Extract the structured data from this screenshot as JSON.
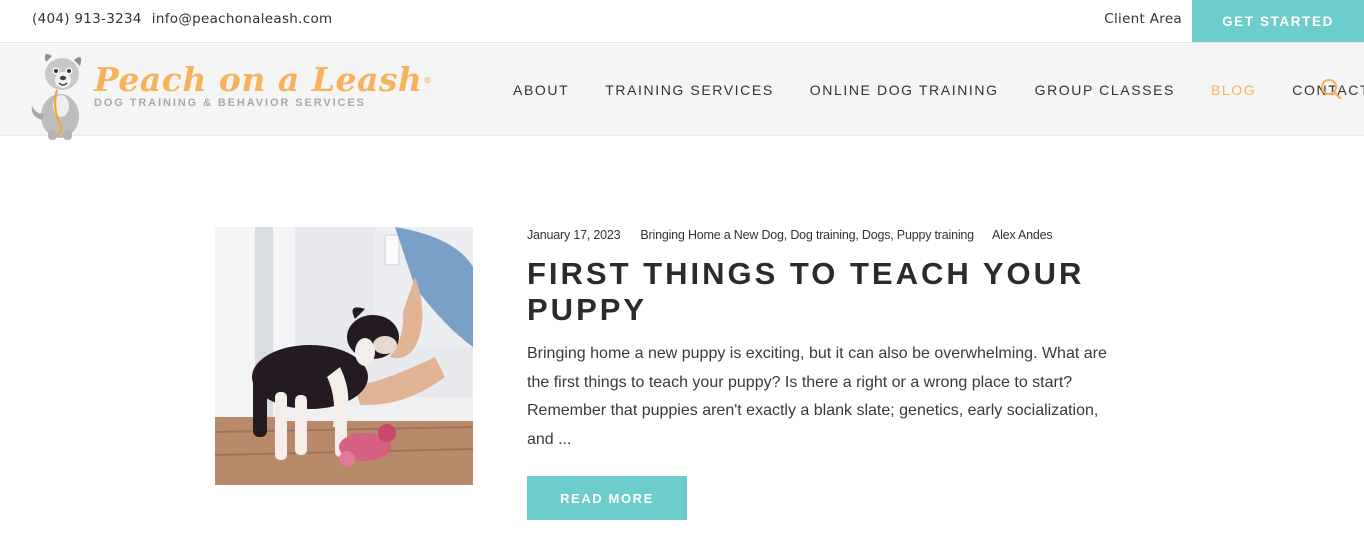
{
  "topbar": {
    "phone": "(404) 913-3234",
    "email": "info@peachonaleash.com",
    "client_area": "Client Area",
    "cta_label": "GET STARTED"
  },
  "brand": {
    "name": "Peach on a Leash",
    "tagline": "DOG TRAINING & BEHAVIOR SERVICES",
    "reg_mark": "®"
  },
  "nav": {
    "items": [
      {
        "label": "ABOUT",
        "active": false
      },
      {
        "label": "TRAINING SERVICES",
        "active": false
      },
      {
        "label": "ONLINE DOG TRAINING",
        "active": false
      },
      {
        "label": "GROUP CLASSES",
        "active": false
      },
      {
        "label": "BLOG",
        "active": true
      },
      {
        "label": "CONTACT",
        "active": false
      }
    ],
    "search_icon": "search-icon"
  },
  "post": {
    "date": "January 17, 2023",
    "categories": "Bringing Home a New Dog, Dog training, Dogs, Puppy training",
    "author": "Alex Andes",
    "title": "FIRST THINGS TO TEACH YOUR PUPPY",
    "excerpt": "Bringing home a new puppy is exciting, but it can also be overwhelming. What are the first things to teach your puppy? Is there a right or a wrong place to start? Remember that puppies aren't exactly a blank slate; genetics, early socialization, and ...",
    "read_more": "READ MORE"
  },
  "colors": {
    "accent_teal": "#6ccdca",
    "brand_peach": "#f7b35c",
    "text_dark": "#2b2b2b",
    "header_bg": "#f5f5f5"
  }
}
